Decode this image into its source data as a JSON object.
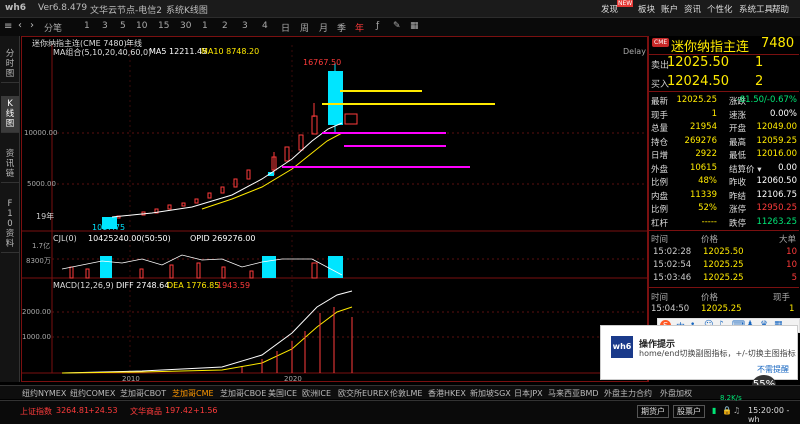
{
  "titlebar": {
    "app": "wh6",
    "version": "Ver6.8.479",
    "server": "文华云节点-电信2",
    "window": "系统K线图",
    "menu": [
      "发现",
      "板块",
      "账户",
      "资讯",
      "个性化",
      "系统工具",
      "帮助"
    ],
    "new_badge": "NEW"
  },
  "toolbar": {
    "periods": [
      "分笔",
      "1",
      "3",
      "5",
      "10",
      "15",
      "30",
      "1",
      "2",
      "3",
      "4",
      "日",
      "周",
      "月",
      "季",
      "年"
    ],
    "selected_period": "年",
    "symbol_tag": "迷你纳指主连(CME 7480)",
    "period_label": "年线"
  },
  "lefttabs": [
    "分时图",
    "K线图",
    "资讯链",
    "F10资料"
  ],
  "chart": {
    "ma_label": "MA组合(5,10,20,40,60,0)",
    "ma5": "MA5 12211.45",
    "ma10": "MA10 8748.20",
    "delay": "Delay",
    "high_label": "16767.50",
    "low_label": "1017.75",
    "year_label": "19年",
    "y_ticks": [
      "10000.00",
      "5000.00"
    ],
    "cjl_label": "CJL(0)",
    "cjl_values": "10425240.00(50:50)",
    "opid": "OPID 269276.00",
    "vol_ticks": [
      "1.7亿",
      "8300万"
    ],
    "macd_label": "MACD(12,26,9)",
    "diff": "DIFF 2748.64",
    "dea": "DEA 1776.85",
    "macd_val": "1943.59",
    "macd_ticks": [
      "2000.00",
      "1000.00"
    ],
    "x_ticks": [
      "2010",
      "2020"
    ]
  },
  "quote": {
    "badge": "CME",
    "name": "迷你纳指主连",
    "code": "7480",
    "sell_label": "卖出",
    "sell_price": "12025.50",
    "sell_qty": "1",
    "buy_label": "买入",
    "buy_price": "12024.50",
    "buy_qty": "2",
    "rows": [
      [
        "最新",
        "12025.25",
        "涨跌",
        "-81.50/-0.67%"
      ],
      [
        "现手",
        "1",
        "速涨",
        "0.00%"
      ],
      [
        "总量",
        "21954",
        "开盘",
        "12049.00"
      ],
      [
        "持仓",
        "269276",
        "最高",
        "12059.25"
      ],
      [
        "日增",
        "2922",
        "最低",
        "12016.00"
      ],
      [
        "外盘",
        "10615",
        "结算价 ▾",
        "0.00"
      ],
      [
        "比例",
        "48%",
        "昨收",
        "12060.50"
      ],
      [
        "内盘",
        "11339",
        "昨结",
        "12106.75"
      ],
      [
        "比例",
        "52%",
        "涨停",
        "12950.25"
      ],
      [
        "杠杆",
        "-----",
        "跌停",
        "11263.25"
      ]
    ],
    "ticks_header": [
      "时间",
      "价格",
      "大单"
    ],
    "ticks": [
      [
        "15:02:28",
        "12025.50",
        "10"
      ],
      [
        "15:02:54",
        "12025.25",
        "10"
      ],
      [
        "15:03:46",
        "12025.25",
        "5"
      ]
    ],
    "ticks2_header": [
      "时间",
      "价格",
      "现手"
    ],
    "ticks2": [
      [
        "15:04:50",
        "12025.25",
        "1"
      ]
    ]
  },
  "bottomtabs": [
    "纽约NYMEX",
    "纽约COMEX",
    "芝加哥CBOT",
    "芝加哥CME",
    "芝加哥CBOE",
    "美国ICE",
    "欧洲ICE",
    "欧交所EUREX",
    "伦敦LME",
    "香港HKEX",
    "新加坡SGX",
    "日本JPX",
    "马来西亚BMD",
    "外盘主力合约",
    "外盘加权"
  ],
  "statusbar": {
    "index_label": "上证指数",
    "index_value": "3264.81",
    "index_change": "+24.53",
    "goods_label": "文华商品",
    "goods_value": "197.42",
    "goods_change": "+1.56",
    "btn1": "期货户",
    "btn2": "股票户",
    "net": "8.2K/s",
    "pct": "55%",
    "time": "15:20:00 - wh"
  },
  "popup": {
    "title": "操作提示",
    "body": "home/end切换副图指标，+/-切换主图指标",
    "dismiss": "不需提醒",
    "logo": "wh6"
  },
  "colors": {
    "up": "#ff3b3b",
    "down": "#00e5ff",
    "ma5": "#ffffff",
    "ma10": "#ffea00",
    "magenta": "#ff00ff"
  }
}
